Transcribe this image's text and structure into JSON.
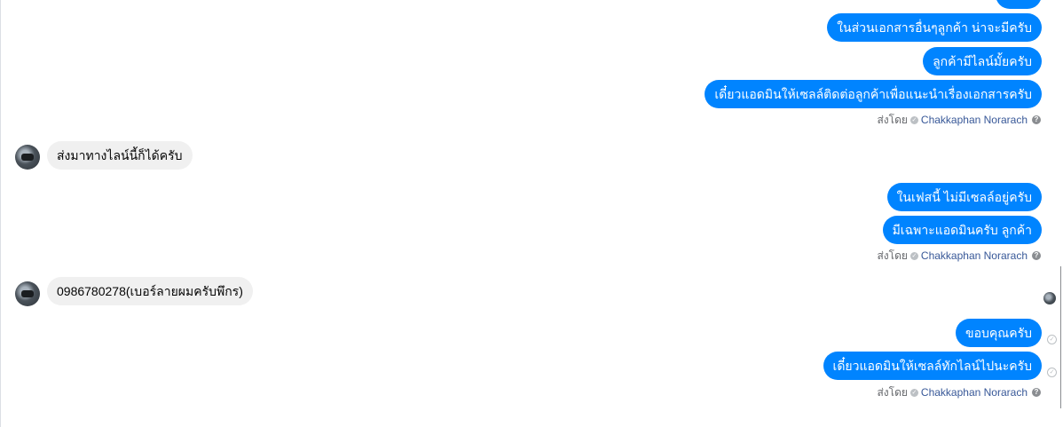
{
  "messages": {
    "group1": {
      "outgoing": [
        "",
        "ในส่วนเอกสารอื่นๆลูกค้า น่าจะมีครับ",
        "ลูกค้ามีไลน์มั้ยครับ",
        "เดี๋ยวแอดมินให้เซลล์ติดต่อลูกค้าเพื่อแนะนำเรื่องเอกสารครับ"
      ],
      "sent_by_prefix": "ส่งโดย",
      "sent_by_name": "Chakkaphan Norarach"
    },
    "incoming1": "ส่งมาทางไลน์นี้ก็ได้ครับ",
    "group2": {
      "outgoing": [
        "ในเฟสนี้ ไม่มีเซลล์อยู่ครับ",
        "มีเฉพาะแอดมินครับ ลูกค้า"
      ],
      "sent_by_prefix": "ส่งโดย",
      "sent_by_name": "Chakkaphan Norarach"
    },
    "incoming2": "0986780278(เบอร์ลายผมครับพึกร)",
    "group3": {
      "outgoing": [
        "ขอบคุณครับ",
        "เดี๋ยวแอดมินให้เซลล์ทักไลน์ไปนะครับ"
      ],
      "sent_by_prefix": "ส่งโดย",
      "sent_by_name": "Chakkaphan Norarach"
    }
  },
  "icons": {
    "check": "✓",
    "help": "?"
  },
  "colors": {
    "outgoing_bubble": "#0084ff",
    "incoming_bubble": "#f0f0f0",
    "sender_name": "#385898"
  }
}
